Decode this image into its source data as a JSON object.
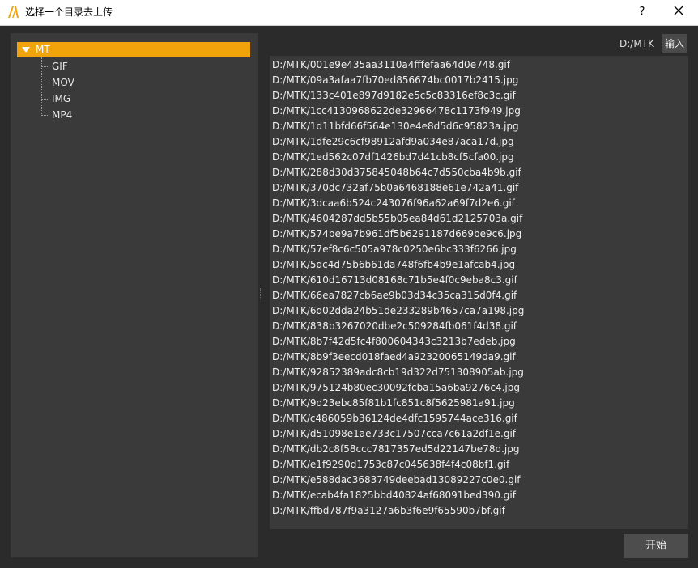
{
  "window": {
    "title": "选择一个目录去上传",
    "help_label": "?",
    "close_icon": "close-icon",
    "app_icon": "app-logo-icon",
    "accent_color": "#f0a30a"
  },
  "tree": {
    "root": {
      "label": "MT",
      "expanded": true,
      "selected": true
    },
    "children": [
      {
        "label": "GIF"
      },
      {
        "label": "MOV"
      },
      {
        "label": "IMG"
      },
      {
        "label": "MP4"
      }
    ]
  },
  "toolbar": {
    "path": "D:/MTK",
    "input_label": "输入"
  },
  "files": [
    "D:/MTK/001e9e435aa3110a4fffefaa64d0e748.gif",
    "D:/MTK/09a3afaa7fb70ed856674bc0017b2415.jpg",
    "D:/MTK/133c401e897d9182e5c5c83316ef8c3c.gif",
    "D:/MTK/1cc4130968622de32966478c1173f949.jpg",
    "D:/MTK/1d11bfd66f564e130e4e8d5d6c95823a.jpg",
    "D:/MTK/1dfe29c6cf98912afd9a034e87aca17d.jpg",
    "D:/MTK/1ed562c07df1426bd7d41cb8cf5cfa00.jpg",
    "D:/MTK/288d30d375845048b64c7d550cba4b9b.gif",
    "D:/MTK/370dc732af75b0a6468188e61e742a41.gif",
    "D:/MTK/3dcaa6b524c243076f96a62a69f7d2e6.gif",
    "D:/MTK/4604287dd5b55b05ea84d61d2125703a.gif",
    "D:/MTK/574be9a7b961df5b6291187d669be9c6.jpg",
    "D:/MTK/57ef8c6c505a978c0250e6bc333f6266.jpg",
    "D:/MTK/5dc4d75b6b61da748f6fb4b9e1afcab4.jpg",
    "D:/MTK/610d16713d08168c71b5e4f0c9eba8c3.gif",
    "D:/MTK/66ea7827cb6ae9b03d34c35ca315d0f4.gif",
    "D:/MTK/6d02dda24b51de233289b4657ca7a198.jpg",
    "D:/MTK/838b3267020dbe2c509284fb061f4d38.gif",
    "D:/MTK/8b7f42d5fc4f800604343c3213b7edeb.jpg",
    "D:/MTK/8b9f3eecd018faed4a92320065149da9.gif",
    "D:/MTK/92852389adc8cb19d322d751308905ab.jpg",
    "D:/MTK/975124b80ec30092fcba15a6ba9276c4.jpg",
    "D:/MTK/9d23ebc85f81b1fc851c8f5625981a91.jpg",
    "D:/MTK/c486059b36124de4dfc1595744ace316.gif",
    "D:/MTK/d51098e1ae733c17507cca7c61a2df1e.gif",
    "D:/MTK/db2c8f58ccc7817357ed5d22147be78d.jpg",
    "D:/MTK/e1f9290d1753c87c045638f4f4c08bf1.gif",
    "D:/MTK/e588dac3683749deebad13089227c0e0.gif",
    "D:/MTK/ecab4fa1825bbd40824af68091bed390.gif",
    "D:/MTK/ffbd787f9a3127a6b3f6e9f65590b7bf.gif"
  ],
  "footer": {
    "start_label": "开始"
  }
}
